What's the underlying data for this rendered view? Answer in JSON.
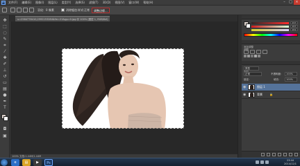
{
  "app": {
    "logo_text": "Ps",
    "menus": [
      "文件(F)",
      "编辑(E)",
      "图像(I)",
      "图层(L)",
      "类型(Y)",
      "选择(S)",
      "滤镜(T)",
      "3D(D)",
      "视图(V)",
      "窗口(W)",
      "帮助(H)"
    ],
    "window_controls": {
      "minimize": "–",
      "maximize": "□",
      "close": "×"
    }
  },
  "options_bar": {
    "feather_label": "羽化:",
    "feather_value": "0 像素",
    "antialias_label": "消除锯齿",
    "style_label": "样式:",
    "style_value": "正常",
    "refine_edge_button": "调整边缘..."
  },
  "document": {
    "tab_title": "u=2584778410,2592153284&fm=21&gp=0.jpg @ 100% (图层 1, RGB/8#)",
    "tab_close": "×",
    "zoom_status": "100%   文档:1.44M/1.44M"
  },
  "tools": [
    "move-icon",
    "marquee-icon",
    "lasso-icon",
    "quick-select-icon",
    "crop-icon",
    "eyedropper-icon",
    "healing-icon",
    "brush-icon",
    "stamp-icon",
    "history-brush-icon",
    "eraser-icon",
    "gradient-icon",
    "blur-icon",
    "dodge-icon",
    "pen-icon",
    "type-icon",
    "path-select-icon",
    "shape-icon",
    "hand-icon",
    "zoom-icon"
  ],
  "color_panel": {
    "title": "颜色",
    "r": "217",
    "g": "207",
    "b": "201",
    "fg_color": "#d9cfc9",
    "bg_color": "#ffffff"
  },
  "adjustments_panel": {
    "title": "调整",
    "add_label": "添加调整"
  },
  "layers_panel": {
    "title": "图层",
    "kind_label": "类型",
    "blend_mode": "正常",
    "opacity_label": "不透明度:",
    "opacity_value": "100%",
    "lock_label": "锁定:",
    "fill_label": "填充:",
    "fill_value": "100%",
    "layers": [
      {
        "name": "图层 1",
        "active": true,
        "locked": ""
      },
      {
        "name": "背景",
        "active": false,
        "locked": "🔒"
      }
    ]
  },
  "taskbar": {
    "clock_time": "23:44",
    "clock_date": "2014/12/1"
  }
}
